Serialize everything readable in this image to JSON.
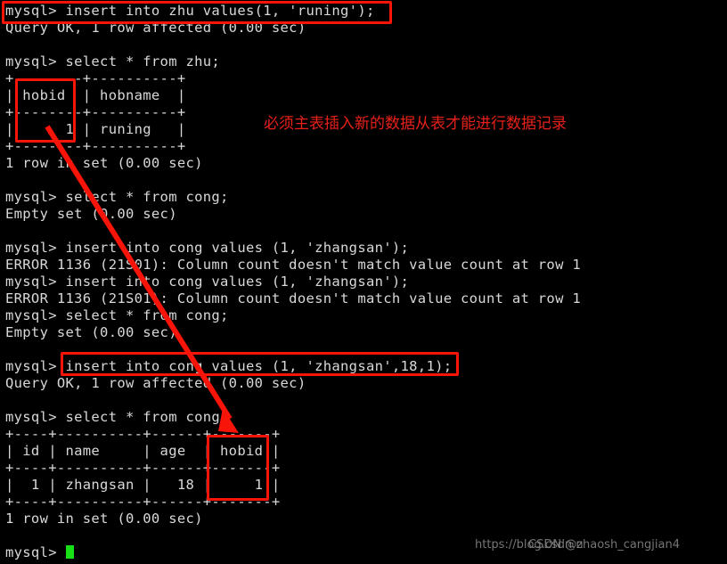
{
  "terminal": {
    "prompt": "mysql>",
    "lines": [
      {
        "id": "l01",
        "text": "mysql> insert into zhu values(1, 'runing');"
      },
      {
        "id": "l02",
        "text": "Query OK, 1 row affected (0.00 sec)"
      },
      {
        "id": "l03",
        "text": ""
      },
      {
        "id": "l04",
        "text": "mysql> select * from zhu;"
      },
      {
        "id": "l05",
        "text": "+--------+----------+"
      },
      {
        "id": "l06",
        "text": "| hobid  | hobname  |"
      },
      {
        "id": "l07",
        "text": "+--------+----------+"
      },
      {
        "id": "l08",
        "text": "|      1 | runing   |"
      },
      {
        "id": "l09",
        "text": "+--------+----------+"
      },
      {
        "id": "l10",
        "text": "1 row in set (0.00 sec)"
      },
      {
        "id": "l11",
        "text": ""
      },
      {
        "id": "l12",
        "text": "mysql> select * from cong;"
      },
      {
        "id": "l13",
        "text": "Empty set (0.00 sec)"
      },
      {
        "id": "l14",
        "text": ""
      },
      {
        "id": "l15",
        "text": "mysql> insert into cong values (1, 'zhangsan');"
      },
      {
        "id": "l16",
        "text": "ERROR 1136 (21S01): Column count doesn't match value count at row 1"
      },
      {
        "id": "l17",
        "text": "mysql> insert into cong values (1, 'zhangsan');"
      },
      {
        "id": "l18",
        "text": "ERROR 1136 (21S01): Column count doesn't match value count at row 1"
      },
      {
        "id": "l19",
        "text": "mysql> select * from cong;"
      },
      {
        "id": "l20",
        "text": "Empty set (0.00 sec)"
      },
      {
        "id": "l21",
        "text": ""
      },
      {
        "id": "l22",
        "text": "mysql> insert into cong values (1, 'zhangsan',18,1);"
      },
      {
        "id": "l23",
        "text": "Query OK, 1 row affected (0.00 sec)"
      },
      {
        "id": "l24",
        "text": ""
      },
      {
        "id": "l25",
        "text": "mysql> select * from cong;"
      },
      {
        "id": "l26",
        "text": "+----+----------+------+-------+"
      },
      {
        "id": "l27",
        "text": "| id | name     | age  | hobid |"
      },
      {
        "id": "l28",
        "text": "+----+----------+------+-------+"
      },
      {
        "id": "l29",
        "text": "|  1 | zhangsan |   18 |     1 |"
      },
      {
        "id": "l30",
        "text": "+----+----------+------+-------+"
      },
      {
        "id": "l31",
        "text": "1 row in set (0.00 sec)"
      },
      {
        "id": "l32",
        "text": ""
      }
    ],
    "final_prompt": "mysql> "
  },
  "result_tables": [
    {
      "name": "zhu",
      "query": "select * from zhu;",
      "columns": [
        "hobid",
        "hobname"
      ],
      "rows": [
        [
          "1",
          "runing"
        ]
      ],
      "footer": "1 row in set (0.00 sec)"
    },
    {
      "name": "cong",
      "query": "select * from cong;",
      "columns": [
        "id",
        "name",
        "age",
        "hobid"
      ],
      "rows": [
        [
          "1",
          "zhangsan",
          "18",
          "1"
        ]
      ],
      "footer": "1 row in set (0.00 sec)"
    }
  ],
  "annotation": {
    "note_text": "必须主表插入新的数据从表才能进行数据记录",
    "color": "#e8201a",
    "highlights": [
      {
        "id": "h-insert-zhu",
        "label": "insert into zhu values(1, 'runing');"
      },
      {
        "id": "h-hobid-parent",
        "label": "hobid column in zhu table"
      },
      {
        "id": "h-insert-cong",
        "label": "insert into cong values (1, 'zhangsan',18,1);"
      },
      {
        "id": "h-hobid-child",
        "label": "hobid column in cong table"
      }
    ],
    "arrow": {
      "from": "zhu.hobid value",
      "to": "cong.hobid value"
    }
  },
  "watermarks": {
    "url": "https://blog.csdn.n",
    "user": "CSDN @zhaosh_cangjian4"
  },
  "colors": {
    "background": "#000000",
    "text": "#d8d8d8",
    "annotation_red": "#f81409",
    "cursor_green": "#17e017",
    "watermark_gray": "#8a8a8a"
  }
}
